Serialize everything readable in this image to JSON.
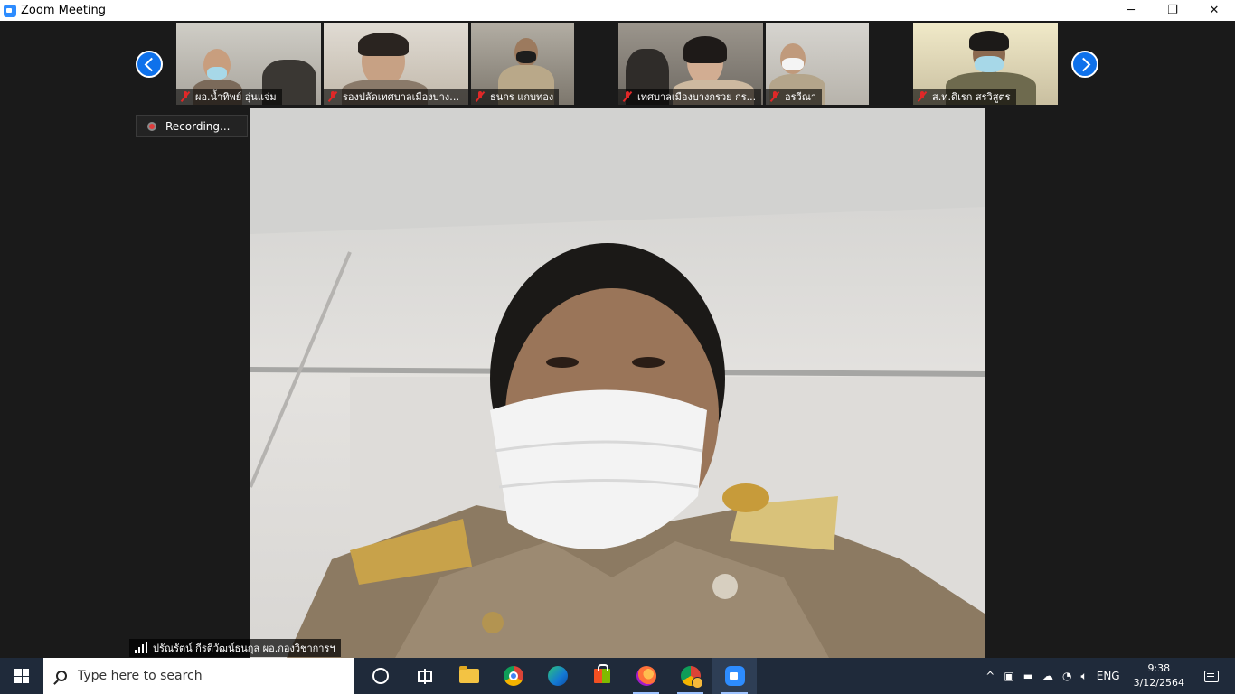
{
  "window": {
    "title": "Zoom Meeting",
    "controls": {
      "minimize": "─",
      "restore": "❐",
      "close": "✕"
    }
  },
  "meeting": {
    "recording_label": "Recording...",
    "gallery": [
      {
        "name": "ผอ.น้ำทิพย์ อุ่นแจ่ม",
        "muted": true,
        "bg": "#b9b6ae"
      },
      {
        "name": "รองปลัดเทศบาลเมืองบางก...",
        "muted": true,
        "bg": "#c9c2b6"
      },
      {
        "name": "ธนกร แกบทอง",
        "muted": true,
        "bg": "#a9a49a"
      },
      {
        "name": "เทศบาลเมืองบางกรวย กร...",
        "muted": true,
        "bg": "#8e8a82"
      },
      {
        "name": "อรวีณา",
        "muted": true,
        "bg": "#c8c6c0"
      },
      {
        "name": "ส.ท.ดิเรก สรวิสูตร",
        "muted": true,
        "bg": "#ddd3ad"
      }
    ],
    "active_speaker": {
      "name": "ปรัณรัตน์   กีรติวัฒน์ธนกุล   ผอ.กองวิชาการฯ"
    }
  },
  "taskbar": {
    "search_placeholder": "Type here to search",
    "apps": [
      "cortana",
      "task-view",
      "file-explorer",
      "chrome",
      "edge",
      "microsoft-store",
      "firefox",
      "chrome-profile",
      "zoom"
    ],
    "tray": {
      "chevron": "^",
      "language": "ENG",
      "time": "9:38",
      "date": "3/12/2564"
    }
  }
}
